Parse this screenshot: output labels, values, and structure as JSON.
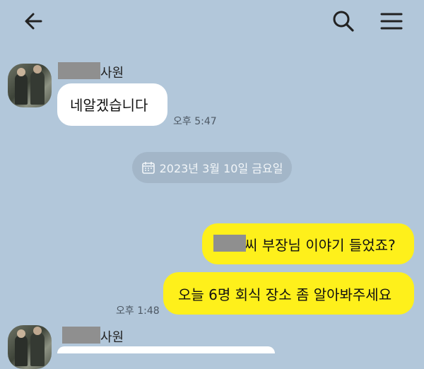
{
  "header": {
    "back_icon": "arrow-left-icon",
    "search_icon": "search-icon",
    "menu_icon": "hamburger-menu-icon"
  },
  "messages": [
    {
      "sender_suffix": "사원",
      "text": "네알겠습니다",
      "time": "오후 5:47"
    },
    {
      "text_suffix": "씨 부장님 이야기 들었죠?"
    },
    {
      "text": "오늘 6명 회식 장소 좀 알아봐주세요",
      "time": "오후 1:48"
    },
    {
      "sender_suffix": "사원"
    }
  ],
  "date_divider": {
    "icon": "calendar-icon",
    "text": "2023년 3월 10일 금요일"
  },
  "colors": {
    "background": "#b2c7da",
    "bubble_outgoing": "#fef01b",
    "bubble_incoming": "#ffffff",
    "redaction": "#8f8f8f"
  }
}
